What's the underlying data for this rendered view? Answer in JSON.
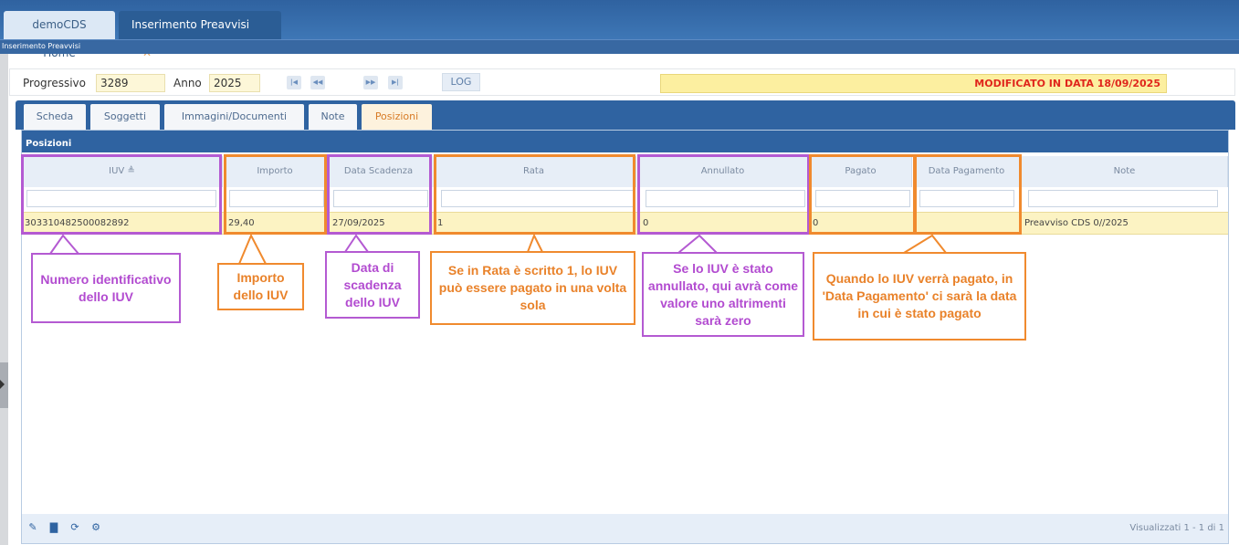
{
  "app_tabs": [
    {
      "label": "demoCDS Home"
    },
    {
      "label": "Inserimento Preavvisi",
      "close": "✕"
    }
  ],
  "breadcrumb": "Inserimento Preavvisi",
  "form": {
    "progressivo_label": "Progressivo",
    "progressivo_value": "3289",
    "anno_label": "Anno",
    "anno_value": "2025",
    "log_label": "LOG",
    "status_banner": "MODIFICATO IN DATA 18/09/2025"
  },
  "tabs": [
    {
      "label": "Scheda"
    },
    {
      "label": "Soggetti"
    },
    {
      "label": "Immagini/Documenti"
    },
    {
      "label": "Note"
    },
    {
      "label": "Posizioni",
      "active": true
    }
  ],
  "grid": {
    "title": "Posizioni",
    "columns": [
      {
        "label": "IUV ≜"
      },
      {
        "label": "Importo"
      },
      {
        "label": "Data Scadenza"
      },
      {
        "label": "Rata"
      },
      {
        "label": "Annullato"
      },
      {
        "label": "Pagato"
      },
      {
        "label": "Data Pagamento"
      },
      {
        "label": "Note"
      }
    ],
    "rows": [
      {
        "iuv": "303310482500082892",
        "importo": "29,40",
        "data_scadenza": "27/09/2025",
        "rata": "1",
        "annullato": "0",
        "pagato": "0",
        "data_pagamento": "",
        "note": "Preavviso CDS 0//2025"
      }
    ],
    "pager": "Visualizzati 1 - 1 di 1"
  },
  "annotations": {
    "iuv": "Numero identificativo dello IUV",
    "importo": "Importo dello IUV",
    "scadenza": "Data di scadenza dello IUV",
    "rata": "Se in Rata è scritto 1, lo IUV può essere pagato in una volta sola",
    "annullato": "Se lo IUV è stato annullato, qui avrà come valore uno altrimenti sarà zero",
    "pagamento": "Quando lo IUV verrà pagato, in 'Data Pagamento' ci sarà la data in cui è stato pagato"
  },
  "colors": {
    "accent": "#2f63a1",
    "purple": "#b45ad2",
    "orange": "#f08a2e",
    "banner_text": "#e0261c"
  }
}
